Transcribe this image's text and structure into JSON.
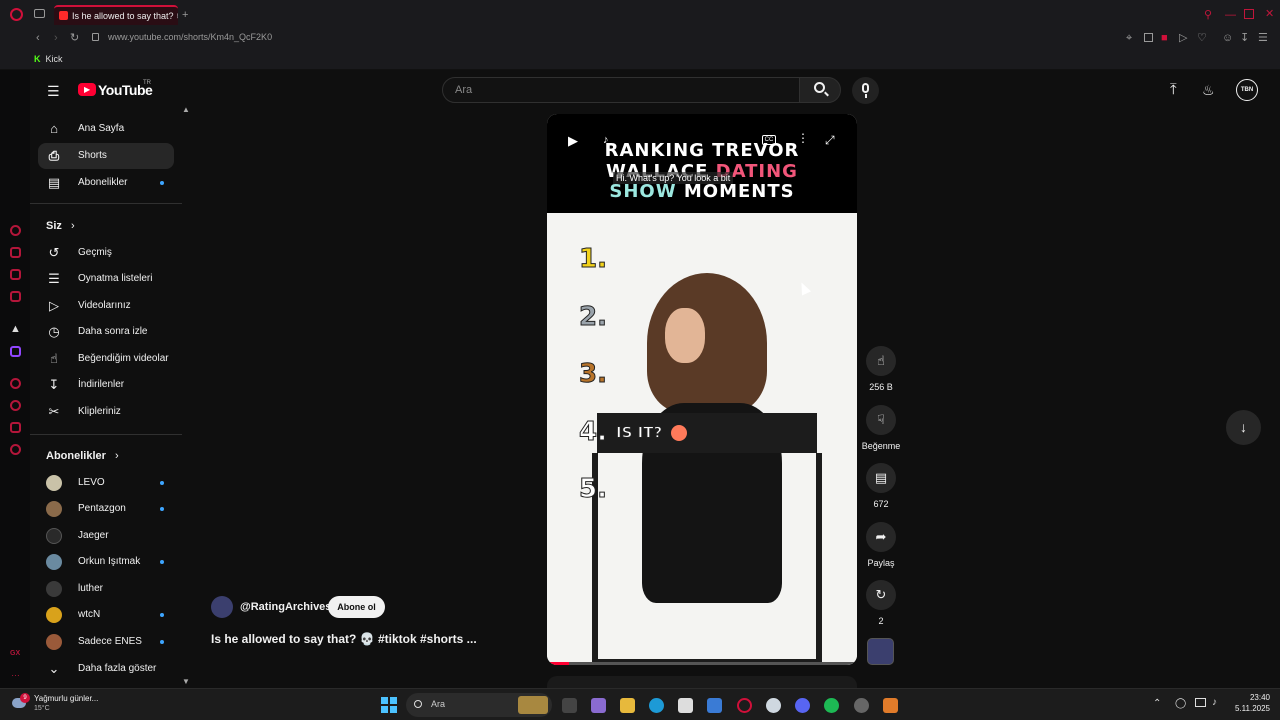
{
  "browser": {
    "tab_title": "Is he allowed to say that? 💀",
    "url": "www.youtube.com/shorts/Km4n_QcF2K0",
    "bookmark": "Kick"
  },
  "header": {
    "logo_text": "YouTube",
    "region": "TR",
    "search_placeholder": "Ara",
    "avatar_text": "TBN"
  },
  "sidebar": {
    "main_items": [
      {
        "label": "Ana Sayfa",
        "icon": "home-icon"
      },
      {
        "label": "Shorts",
        "icon": "shorts-icon"
      },
      {
        "label": "Abonelikler",
        "icon": "subscriptions-icon"
      }
    ],
    "you_heading": "Siz",
    "you_items": [
      {
        "label": "Geçmiş",
        "icon": "history-icon"
      },
      {
        "label": "Oynatma listeleri",
        "icon": "playlists-icon"
      },
      {
        "label": "Videolarınız",
        "icon": "your-videos-icon"
      },
      {
        "label": "Daha sonra izle",
        "icon": "watch-later-icon"
      },
      {
        "label": "Beğendiğim videolar",
        "icon": "liked-videos-icon"
      },
      {
        "label": "İndirilenler",
        "icon": "downloads-icon"
      },
      {
        "label": "Klipleriniz",
        "icon": "clips-icon"
      }
    ],
    "subs_heading": "Abonelikler",
    "subscriptions": [
      {
        "label": "LEVO",
        "color": "#c9c2a8",
        "new": true
      },
      {
        "label": "Pentazgon",
        "color": "#8a6a4a",
        "new": true
      },
      {
        "label": "Jaeger",
        "color": "#2a2a2a",
        "new": false
      },
      {
        "label": "Orkun Işıtmak",
        "color": "#6a8aa0",
        "new": true
      },
      {
        "label": "luther",
        "color": "#3a3a3a",
        "new": false
      },
      {
        "label": "wtcN",
        "color": "#d9a21b",
        "new": true
      },
      {
        "label": "Sadece ENES",
        "color": "#9a5a3a",
        "new": true
      }
    ],
    "show_more": "Daha fazla göster"
  },
  "video": {
    "title_line1": "RANKING TREVOR",
    "title_line2a": "WALLACE",
    "title_line2b": "DATING",
    "title_line3a": "SHOW",
    "title_line3b": "MOMENTS",
    "subtitle": "Hi. What's up? You look a bit",
    "ranks": [
      "1.",
      "2.",
      "3.",
      "4.",
      "5."
    ],
    "rank_colors": [
      "#f2d21b",
      "#9aa3ab",
      "#b8742a",
      "#ffffff",
      "#ffffff"
    ],
    "rank4_text": "IS IT?",
    "progress_fraction": 0.07,
    "channel": "@RatingArchives",
    "subscribe": "Abone ol",
    "caption": "Is he allowed to say that? 💀 #tiktok #shorts ..."
  },
  "actions": {
    "likes": "256 B",
    "dislike": "Beğenme",
    "comments": "672",
    "share": "Paylaş",
    "remix": "2"
  },
  "taskbar": {
    "weather_title": "Yağmurlu günler...",
    "weather_temp": "15°C",
    "weather_badge": "9",
    "search": "Ara",
    "time": "23:40",
    "date": "5.11.2025"
  }
}
